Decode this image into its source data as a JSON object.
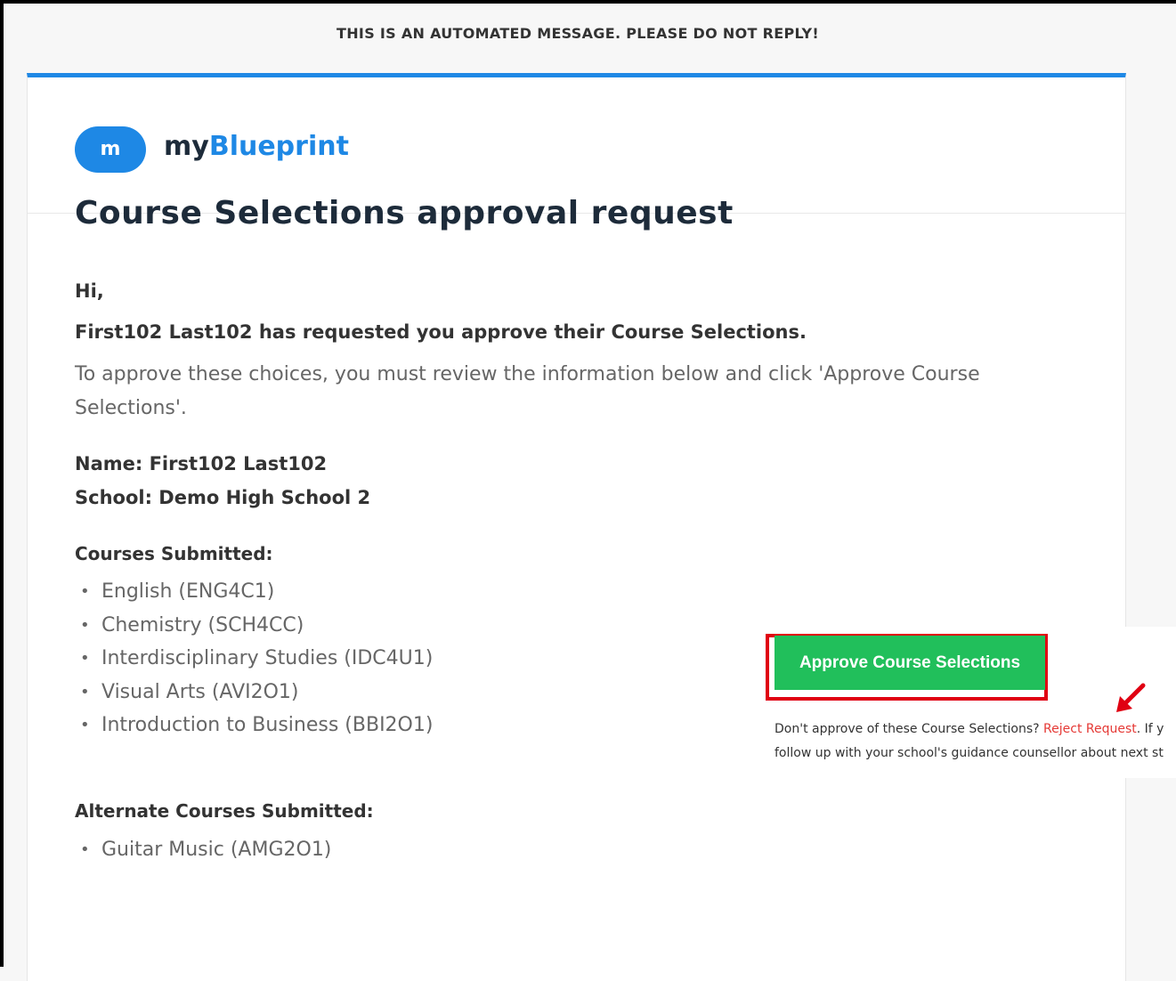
{
  "notice": "THIS IS AN AUTOMATED MESSAGE. PLEASE DO NOT REPLY!",
  "brand": {
    "logo_glyph": "m",
    "name_part1": "my",
    "name_part2": "Blueprint",
    "accent_color": "#1e88e5"
  },
  "email": {
    "title": "Course Selections approval request",
    "greeting": "Hi,",
    "requested": "First102 Last102 has requested you approve their Course Selections.",
    "instruction": "To approve these choices, you must review the information below and click 'Approve Course Selections'.",
    "name_line": "Name: First102 Last102",
    "school_line": "School: Demo High School 2",
    "courses_heading": "Courses Submitted:",
    "courses": [
      "English (ENG4C1)",
      "Chemistry (SCH4CC)",
      "Interdisciplinary Studies (IDC4U1)",
      "Visual Arts (AVI2O1)",
      "Introduction to Business (BBI2O1)"
    ],
    "alt_heading": "Alternate Courses Submitted:",
    "alt_courses": [
      "Guitar Music (AMG2O1)"
    ]
  },
  "approve": {
    "button_label": "Approve Course Selections",
    "button_color": "#21bf5b",
    "highlight_color": "#e00012",
    "reject_prefix": "Don't approve of these Course Selections? ",
    "reject_link": "Reject Request",
    "reject_suffix": ". If y",
    "reject_line2": "follow up with your school's guidance counsellor about next st"
  }
}
